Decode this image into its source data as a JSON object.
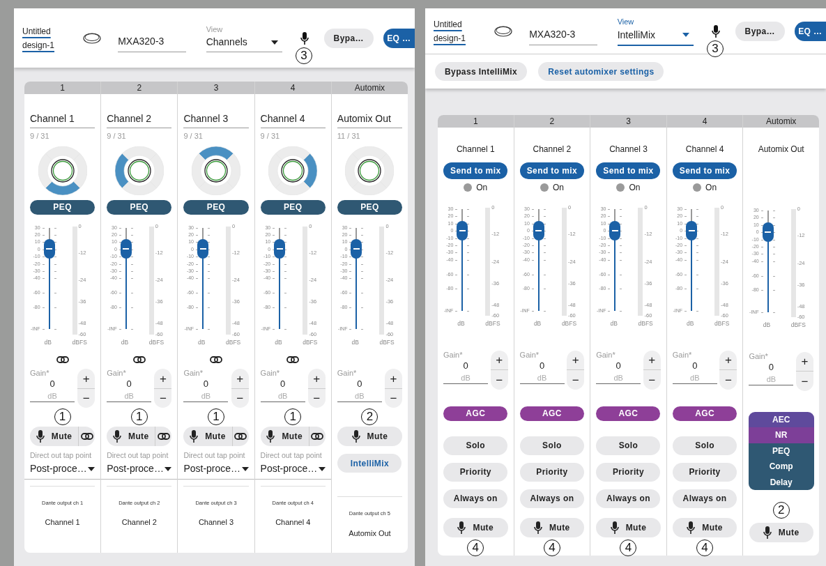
{
  "panels": [
    {
      "kind": "channels",
      "design": "Untitled design-1",
      "device": "MXA320-3",
      "view": {
        "label": "View",
        "value": "Channels",
        "focused": false
      },
      "bypass": "Bypa…",
      "eq": "EQ …",
      "mic_callout": "3",
      "strips": [
        {
          "header": "1",
          "name": "Channel 1",
          "count": "9 / 31",
          "lobes": [
            {
              "selected": false
            },
            {
              "selected": false
            },
            {
              "selected": true
            },
            {
              "selected": false
            }
          ],
          "peq": "PEQ",
          "fader_scale": [
            "30",
            "20",
            "10",
            "0",
            "-10",
            "-20",
            "-30",
            "-40",
            "-60",
            "-80",
            "-INF"
          ],
          "level": 0.79,
          "meter_scale": [
            "0",
            "-12",
            "-24",
            "-36",
            "-48",
            "-60"
          ],
          "fader_unit": "dB",
          "meter_unit": "dBFS",
          "gain_link": true,
          "gain_label": "Gain*",
          "gain_value": "0",
          "gain_unit": "dB",
          "gain_up": "+",
          "gain_down": "−",
          "callout": "1",
          "mute": "Mute",
          "mute_link": true,
          "tap_label": "Direct out tap point",
          "tap_value": "Post-proce…",
          "dante_label": "Dante output ch 1",
          "dante_name": "Channel 1"
        },
        {
          "header": "2",
          "name": "Channel 2",
          "count": "9 / 31",
          "lobes": [
            {
              "selected": false
            },
            {
              "selected": false
            },
            {
              "selected": false
            },
            {
              "selected": true
            }
          ],
          "peq": "PEQ",
          "fader_scale": [
            "30",
            "20",
            "10",
            "0",
            "-10",
            "-20",
            "-30",
            "-40",
            "-60",
            "-80",
            "-INF"
          ],
          "level": 0.79,
          "meter_scale": [
            "0",
            "-12",
            "-24",
            "-36",
            "-48",
            "-60"
          ],
          "fader_unit": "dB",
          "meter_unit": "dBFS",
          "gain_link": true,
          "gain_label": "Gain*",
          "gain_value": "0",
          "gain_unit": "dB",
          "gain_up": "+",
          "gain_down": "−",
          "callout": "1",
          "mute": "Mute",
          "mute_link": true,
          "tap_label": "Direct out tap point",
          "tap_value": "Post-proce…",
          "dante_label": "Dante output ch 2",
          "dante_name": "Channel 2"
        },
        {
          "header": "3",
          "name": "Channel 3",
          "count": "9 / 31",
          "lobes": [
            {
              "selected": true
            },
            {
              "selected": false
            },
            {
              "selected": false
            },
            {
              "selected": false
            }
          ],
          "peq": "PEQ",
          "fader_scale": [
            "30",
            "20",
            "10",
            "0",
            "-10",
            "-20",
            "-30",
            "-40",
            "-60",
            "-80",
            "-INF"
          ],
          "level": 0.79,
          "meter_scale": [
            "0",
            "-12",
            "-24",
            "-36",
            "-48",
            "-60"
          ],
          "fader_unit": "dB",
          "meter_unit": "dBFS",
          "gain_link": true,
          "gain_label": "Gain*",
          "gain_value": "0",
          "gain_unit": "dB",
          "gain_up": "+",
          "gain_down": "−",
          "callout": "1",
          "mute": "Mute",
          "mute_link": true,
          "tap_label": "Direct out tap point",
          "tap_value": "Post-proce…",
          "dante_label": "Dante output ch 3",
          "dante_name": "Channel 3"
        },
        {
          "header": "4",
          "name": "Channel 4",
          "count": "9 / 31",
          "lobes": [
            {
              "selected": false
            },
            {
              "selected": true
            },
            {
              "selected": false
            },
            {
              "selected": false
            }
          ],
          "peq": "PEQ",
          "fader_scale": [
            "30",
            "20",
            "10",
            "0",
            "-10",
            "-20",
            "-30",
            "-40",
            "-60",
            "-80",
            "-INF"
          ],
          "level": 0.79,
          "meter_scale": [
            "0",
            "-12",
            "-24",
            "-36",
            "-48",
            "-60"
          ],
          "fader_unit": "dB",
          "meter_unit": "dBFS",
          "gain_link": true,
          "gain_label": "Gain*",
          "gain_value": "0",
          "gain_unit": "dB",
          "gain_up": "+",
          "gain_down": "−",
          "callout": "1",
          "mute": "Mute",
          "mute_link": true,
          "tap_label": "Direct out tap point",
          "tap_value": "Post-proce…",
          "dante_label": "Dante output ch 4",
          "dante_name": "Channel 4"
        },
        {
          "header": "Automix",
          "name": "Automix Out",
          "count": "11 / 31",
          "lobes": [
            {
              "selected": false
            },
            {
              "selected": false
            },
            {
              "selected": false
            },
            {
              "selected": false
            }
          ],
          "peq": "PEQ",
          "fader_scale": [
            "30",
            "20",
            "10",
            "0",
            "-10",
            "-20",
            "-30",
            "-40",
            "-60",
            "-80",
            "-INF"
          ],
          "level": 0.79,
          "meter_scale": [
            "0",
            "-12",
            "-24",
            "-36",
            "-48",
            "-60"
          ],
          "fader_unit": "dB",
          "meter_unit": "dBFS",
          "gain_link": false,
          "gain_label": "Gain*",
          "gain_value": "0",
          "gain_unit": "dB",
          "gain_up": "+",
          "gain_down": "−",
          "callout": "2",
          "mute": "Mute",
          "mute_link": false,
          "intellimix": "IntelliMix",
          "dante_label": "Dante output ch 5",
          "dante_name": "Automix Out"
        }
      ]
    },
    {
      "kind": "intellimix",
      "design": "Untitled design-1",
      "device": "MXA320-3",
      "view": {
        "label": "View",
        "value": "IntelliMix",
        "focused": true
      },
      "bypass": "Bypa…",
      "eq": "EQ …",
      "mic_callout": "3",
      "toolbar": [
        {
          "label": "Bypass IntelliMix",
          "kind": "plain"
        },
        {
          "label": "Reset automixer settings",
          "kind": "accent"
        }
      ],
      "strips": [
        {
          "header": "1",
          "name": "Channel 1",
          "send": "Send to mix",
          "indicator": "On",
          "indicator_on": false,
          "fader_scale": [
            "30",
            "20",
            "10",
            "0",
            "-10",
            "-20",
            "-30",
            "-40",
            "-60",
            "-80",
            "-INF"
          ],
          "level": 0.79,
          "meter_scale": [
            "0",
            "-12",
            "-24",
            "-36",
            "-48",
            "-60"
          ],
          "fader_unit": "dB",
          "meter_unit": "dBFS",
          "gain_label": "Gain*",
          "gain_value": "0",
          "gain_unit": "dB",
          "gain_up": "+",
          "gain_down": "−",
          "agc": "AGC",
          "solo": "Solo",
          "priority": "Priority",
          "always_on": "Always on",
          "mute": "Mute",
          "callout": "4"
        },
        {
          "header": "2",
          "name": "Channel 2",
          "send": "Send to mix",
          "indicator": "On",
          "indicator_on": false,
          "fader_scale": [
            "30",
            "20",
            "10",
            "0",
            "-10",
            "-20",
            "-30",
            "-40",
            "-60",
            "-80",
            "-INF"
          ],
          "level": 0.79,
          "meter_scale": [
            "0",
            "-12",
            "-24",
            "-36",
            "-48",
            "-60"
          ],
          "fader_unit": "dB",
          "meter_unit": "dBFS",
          "gain_label": "Gain*",
          "gain_value": "0",
          "gain_unit": "dB",
          "gain_up": "+",
          "gain_down": "−",
          "agc": "AGC",
          "solo": "Solo",
          "priority": "Priority",
          "always_on": "Always on",
          "mute": "Mute",
          "callout": "4"
        },
        {
          "header": "3",
          "name": "Channel 3",
          "send": "Send to mix",
          "indicator": "On",
          "indicator_on": false,
          "fader_scale": [
            "30",
            "20",
            "10",
            "0",
            "-10",
            "-20",
            "-30",
            "-40",
            "-60",
            "-80",
            "-INF"
          ],
          "level": 0.79,
          "meter_scale": [
            "0",
            "-12",
            "-24",
            "-36",
            "-48",
            "-60"
          ],
          "fader_unit": "dB",
          "meter_unit": "dBFS",
          "gain_label": "Gain*",
          "gain_value": "0",
          "gain_unit": "dB",
          "gain_up": "+",
          "gain_down": "−",
          "agc": "AGC",
          "solo": "Solo",
          "priority": "Priority",
          "always_on": "Always on",
          "mute": "Mute",
          "callout": "4"
        },
        {
          "header": "4",
          "name": "Channel 4",
          "send": "Send to mix",
          "indicator": "On",
          "indicator_on": false,
          "fader_scale": [
            "30",
            "20",
            "10",
            "0",
            "-10",
            "-20",
            "-30",
            "-40",
            "-60",
            "-80",
            "-INF"
          ],
          "level": 0.79,
          "meter_scale": [
            "0",
            "-12",
            "-24",
            "-36",
            "-48",
            "-60"
          ],
          "fader_unit": "dB",
          "meter_unit": "dBFS",
          "gain_label": "Gain*",
          "gain_value": "0",
          "gain_unit": "dB",
          "gain_up": "+",
          "gain_down": "−",
          "agc": "AGC",
          "solo": "Solo",
          "priority": "Priority",
          "always_on": "Always on",
          "mute": "Mute",
          "callout": "4"
        },
        {
          "header": "Automix",
          "name": "Automix Out",
          "fader_scale": [
            "30",
            "20",
            "10",
            "0",
            "-10",
            "-20",
            "-30",
            "-40",
            "-60",
            "-80",
            "-INF"
          ],
          "level": 0.79,
          "meter_scale": [
            "0",
            "-12",
            "-24",
            "-36",
            "-48",
            "-60"
          ],
          "fader_unit": "dB",
          "meter_unit": "dBFS",
          "gain_label": "Gain*",
          "gain_value": "0",
          "gain_unit": "dB",
          "gain_up": "+",
          "gain_down": "−",
          "blocks": [
            {
              "label": "AEC",
              "color": "#5f4a9c"
            },
            {
              "label": "NR",
              "color": "#7d3f98"
            },
            {
              "label": "PEQ",
              "color": "#2f5873"
            },
            {
              "label": "Comp",
              "color": "#2f5873"
            },
            {
              "label": "Delay",
              "color": "#2f5873"
            }
          ],
          "mute": "Mute",
          "callout": "2"
        }
      ]
    }
  ]
}
